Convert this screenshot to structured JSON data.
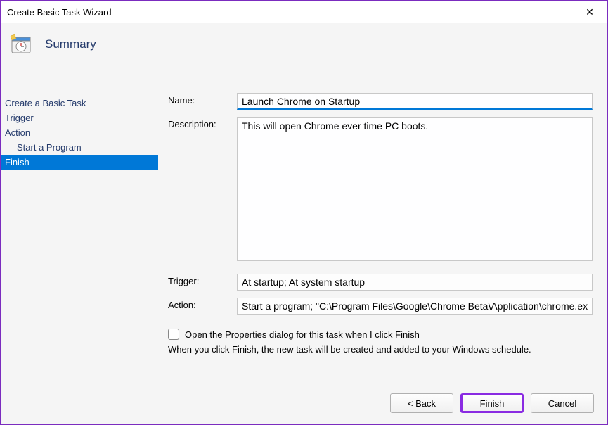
{
  "window": {
    "title": "Create Basic Task Wizard"
  },
  "header": {
    "title": "Summary"
  },
  "sidebar": {
    "items": [
      {
        "label": "Create a Basic Task"
      },
      {
        "label": "Trigger"
      },
      {
        "label": "Action"
      },
      {
        "label": "Start a Program"
      },
      {
        "label": "Finish"
      }
    ]
  },
  "form": {
    "name_label": "Name:",
    "name_value": "Launch Chrome on Startup",
    "desc_label": "Description:",
    "desc_value": "This will open Chrome ever time PC boots.",
    "trigger_label": "Trigger:",
    "trigger_value": "At startup; At system startup",
    "action_label": "Action:",
    "action_value": "Start a program; \"C:\\Program Files\\Google\\Chrome Beta\\Application\\chrome.ex",
    "checkbox_label": "Open the Properties dialog for this task when I click Finish",
    "info_text": "When you click Finish, the new task will be created and added to your Windows schedule."
  },
  "buttons": {
    "back": "< Back",
    "finish": "Finish",
    "cancel": "Cancel"
  }
}
